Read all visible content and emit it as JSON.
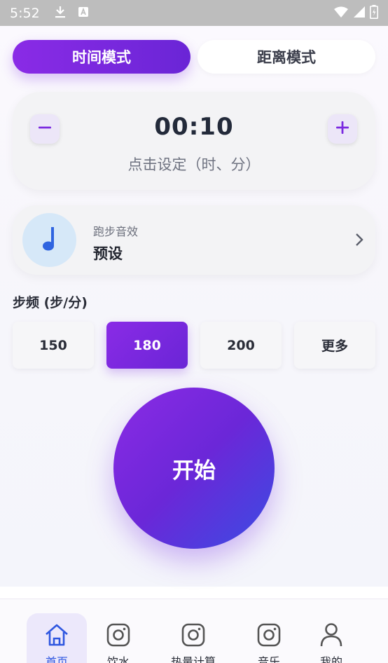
{
  "status_bar": {
    "time": "5:52",
    "icons": [
      "download-icon",
      "text-a-icon",
      "wifi-icon",
      "signal-icon",
      "battery-icon"
    ]
  },
  "mode_tabs": [
    {
      "label": "时间模式",
      "active": true
    },
    {
      "label": "距离模式",
      "active": false
    }
  ],
  "timer": {
    "value": "00:10",
    "hint": "点击设定（时、分）",
    "decrement_icon": "minus-icon",
    "increment_icon": "plus-icon"
  },
  "sound": {
    "label": "跑步音效",
    "value": "预设",
    "icon": "music-note-icon"
  },
  "cadence": {
    "title": "步频 (步/分)",
    "options": [
      "150",
      "180",
      "200",
      "更多"
    ],
    "selected": "180"
  },
  "start_button": {
    "label": "开始"
  },
  "bottom_nav": [
    {
      "label": "首页",
      "icon": "home-icon",
      "active": true
    },
    {
      "label": "饮水",
      "icon": "camera-icon",
      "active": false
    },
    {
      "label": "热量计算",
      "icon": "camera-icon",
      "active": false
    },
    {
      "label": "音乐",
      "icon": "camera-icon",
      "active": false
    },
    {
      "label": "我的",
      "icon": "user-icon",
      "active": false
    }
  ],
  "colors": {
    "accent_start": "#8a2be6",
    "accent_end": "#6a25d6",
    "start_button_end": "#3a4de3",
    "nav_active": "#2f57e0"
  }
}
